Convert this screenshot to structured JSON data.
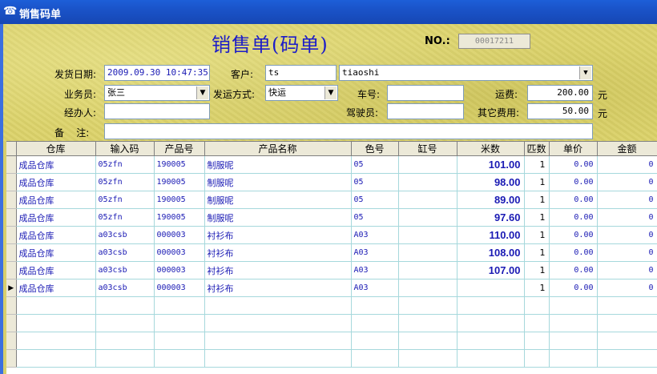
{
  "window": {
    "title": "销售码单",
    "icon": "telephone-icon"
  },
  "header": {
    "title": "销售单(码单)",
    "no_label": "NO.:",
    "no_value": "00017211"
  },
  "fields": {
    "ship_date_label": "发货日期:",
    "ship_date": "2009.09.30 10:47:35",
    "customer_label": "客户:",
    "customer_code": "ts",
    "customer_name": "tiaoshi",
    "salesman_label": "业务员:",
    "salesman": "张三",
    "ship_method_label": "发运方式:",
    "ship_method": "快运",
    "car_no_label": "车号:",
    "car_no": "",
    "freight_label": "运费:",
    "freight": "200.00",
    "freight_unit": "元",
    "handler_label": "经办人:",
    "handler": "",
    "driver_label": "驾驶员:",
    "driver": "",
    "other_fee_label": "其它费用:",
    "other_fee": "50.00",
    "other_fee_unit": "元",
    "remark_label": "备    注:",
    "remark": ""
  },
  "table": {
    "columns": [
      "仓库",
      "输入码",
      "产品号",
      "产品名称",
      "色号",
      "缸号",
      "米数",
      "匹数",
      "单价",
      "金额"
    ],
    "rows": [
      [
        "成品仓库",
        "05zfn",
        "190005",
        "制服呢",
        "05",
        "",
        "101.00",
        "1",
        "0.00",
        "0"
      ],
      [
        "成品仓库",
        "05zfn",
        "190005",
        "制服呢",
        "05",
        "",
        "98.00",
        "1",
        "0.00",
        "0"
      ],
      [
        "成品仓库",
        "05zfn",
        "190005",
        "制服呢",
        "05",
        "",
        "89.00",
        "1",
        "0.00",
        "0"
      ],
      [
        "成品仓库",
        "05zfn",
        "190005",
        "制服呢",
        "05",
        "",
        "97.60",
        "1",
        "0.00",
        "0"
      ],
      [
        "成品仓库",
        "a03csb",
        "000003",
        "衬衫布",
        "A03",
        "",
        "110.00",
        "1",
        "0.00",
        "0"
      ],
      [
        "成品仓库",
        "a03csb",
        "000003",
        "衬衫布",
        "A03",
        "",
        "108.00",
        "1",
        "0.00",
        "0"
      ],
      [
        "成品仓库",
        "a03csb",
        "000003",
        "衬衫布",
        "A03",
        "",
        "107.00",
        "1",
        "0.00",
        "0"
      ],
      [
        "成品仓库",
        "a03csb",
        "000003",
        "衬衫布",
        "A03",
        "",
        "",
        "1",
        "0.00",
        "0"
      ]
    ],
    "current_row_marker": "▶",
    "empty_rows": 4
  },
  "colors": {
    "title_bar": "#1a53c8",
    "form_bg": "#dcd36a",
    "title_text": "#1c1cc8",
    "cell_text": "#1a1ab4",
    "grid_line": "#a6d8dc"
  }
}
